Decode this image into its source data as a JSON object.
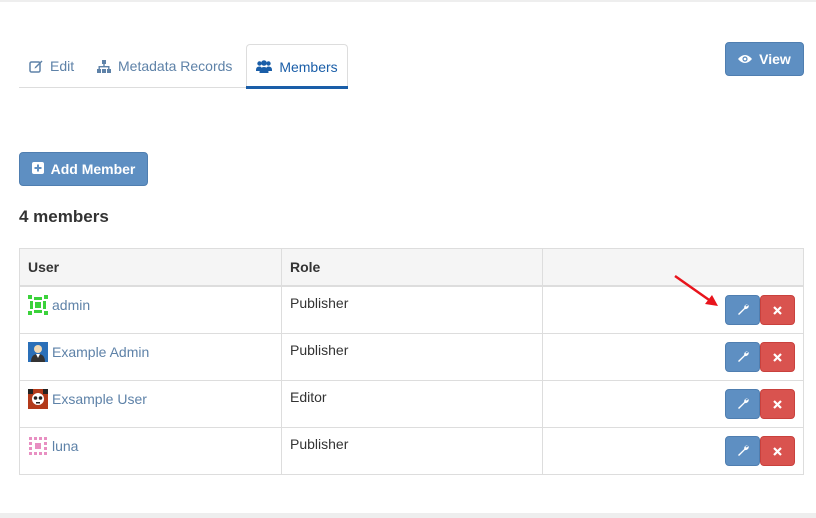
{
  "tabs": [
    {
      "label": "Edit",
      "icon": "edit-icon"
    },
    {
      "label": "Metadata Records",
      "icon": "sitemap-icon"
    },
    {
      "label": "Members",
      "icon": "users-icon",
      "active": true
    }
  ],
  "actions": {
    "view_label": "View",
    "add_member_label": "Add Member"
  },
  "members_heading": "4 members",
  "table": {
    "columns": [
      "User",
      "Role",
      ""
    ],
    "rows": [
      {
        "user": "admin",
        "role": "Publisher"
      },
      {
        "user": "Example Admin",
        "role": "Publisher"
      },
      {
        "user": "Exsample User",
        "role": "Editor"
      },
      {
        "user": "luna",
        "role": "Publisher"
      }
    ]
  },
  "colors": {
    "accent": "#5e8fc2",
    "link": "#5e82a8",
    "danger": "#d9534f",
    "active_tab": "#1a5ea8"
  }
}
